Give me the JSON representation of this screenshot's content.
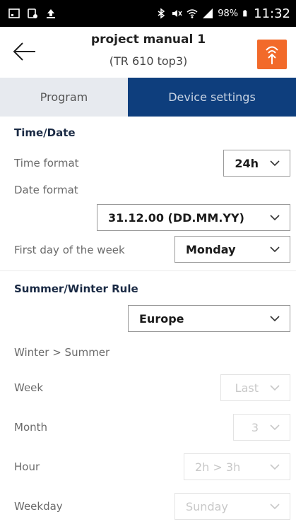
{
  "status_bar": {
    "battery_pct": "98%",
    "time": "11:32",
    "left_icons": [
      "screenshot-icon",
      "cast-icon",
      "upload-icon"
    ],
    "right_icons": [
      "bluetooth-icon",
      "mute-icon",
      "wifi-icon",
      "signal-icon",
      "battery-icon"
    ]
  },
  "header": {
    "title": "project manual 1",
    "subtitle": "(TR 610 top3)",
    "accent_color": "#f26a2a"
  },
  "tabs": [
    {
      "label": "Program",
      "active": false
    },
    {
      "label": "Device settings",
      "active": true
    }
  ],
  "time_date": {
    "heading": "Time/Date",
    "time_format_label": "Time format",
    "time_format_value": "24h",
    "date_format_label": "Date format",
    "date_format_value": "31.12.00 (DD.MM.YY)",
    "first_day_label": "First day of the week",
    "first_day_value": "Monday"
  },
  "summer_winter": {
    "heading": "Summer/Winter Rule",
    "rule_value": "Europe",
    "transition_label": "Winter > Summer",
    "week_label": "Week",
    "week_value": "Last",
    "month_label": "Month",
    "month_value": "3",
    "hour_label": "Hour",
    "hour_value": "2h > 3h",
    "weekday_label": "Weekday",
    "weekday_value": "Sunday"
  },
  "colors": {
    "tab_active_bg": "#0e3e7d",
    "tab_inactive_bg": "#e7eaef"
  }
}
